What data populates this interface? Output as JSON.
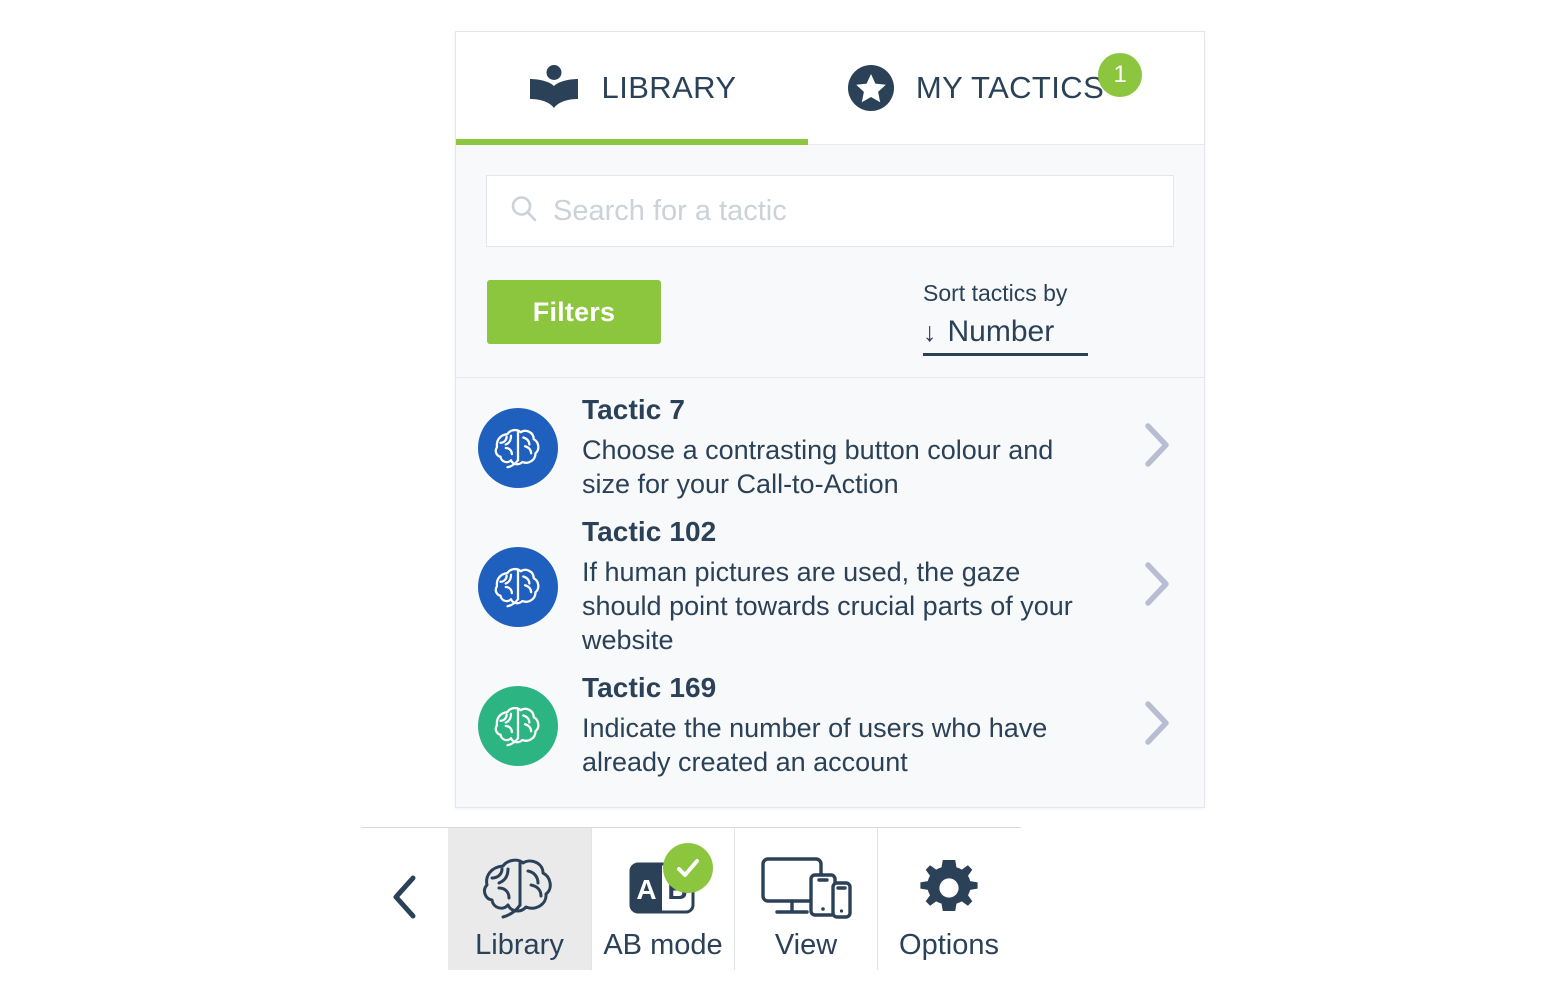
{
  "tabs": [
    {
      "label": "LIBRARY",
      "icon": "open-book-reader-icon",
      "active": true,
      "badge": null
    },
    {
      "label": "MY TACTICS",
      "icon": "star-circle-icon",
      "active": false,
      "badge": "1"
    }
  ],
  "search": {
    "placeholder": "Search for a tactic",
    "value": "",
    "icon": "search-icon"
  },
  "controls": {
    "filters_label": "Filters",
    "sort_label": "Sort tactics by",
    "sort_arrow": "↓",
    "sort_value": "Number"
  },
  "tactics": [
    {
      "title": "Tactic 7",
      "description": "Choose a contrasting button colour and size for your Call-to-Action",
      "icon": "brain-icon",
      "icon_color": "#1f5fbd"
    },
    {
      "title": "Tactic 102",
      "description": "If human pictures are used, the gaze should point towards crucial parts of your website",
      "icon": "brain-icon",
      "icon_color": "#1f5fbd"
    },
    {
      "title": "Tactic 169",
      "description": "Indicate the number of users who have already created an account",
      "icon": "brain-icon",
      "icon_color": "#2cb483"
    }
  ],
  "bottom_bar": {
    "back_icon": "chevron-left-icon",
    "items": [
      {
        "label": "Library",
        "icon": "brain-outline-icon",
        "active": true,
        "badge": null
      },
      {
        "label": "AB mode",
        "icon": "ab-split-icon",
        "active": false,
        "badge": "check-circle-icon"
      },
      {
        "label": "View",
        "icon": "devices-icon",
        "active": false,
        "badge": null
      },
      {
        "label": "Options",
        "icon": "gear-icon",
        "active": false,
        "badge": null
      }
    ]
  },
  "colors": {
    "accent_green": "#8cc63e",
    "navy": "#2b4158",
    "brain_blue": "#1f5fbd",
    "brain_teal": "#2cb483",
    "chevron_grey": "#b9bdd3",
    "panel_bg": "#f8f9fa"
  }
}
